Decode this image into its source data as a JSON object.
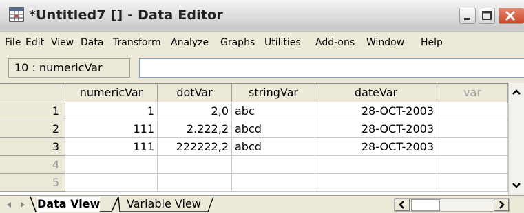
{
  "window": {
    "title": "*Untitled7 [] - Data Editor"
  },
  "menu": [
    "File",
    "Edit",
    "View",
    "Data",
    "Transform",
    "Analyze",
    "Graphs",
    "Utilities",
    "Add-ons",
    "Window",
    "Help"
  ],
  "cell_reference": {
    "label": "10 : numericVar",
    "value": ""
  },
  "grid": {
    "columns": [
      "numericVar",
      "dotVar",
      "stringVar",
      "dateVar",
      "var"
    ],
    "row_numbers": [
      "1",
      "2",
      "3",
      "4",
      "5"
    ],
    "rows": [
      [
        "1",
        "2,0",
        "abc",
        "28-OCT-2003",
        ""
      ],
      [
        "111",
        "2.222,2",
        "abcd",
        "28-OCT-2003",
        ""
      ],
      [
        "111",
        "222222,2",
        "abcd",
        "28-OCT-2003",
        ""
      ],
      [
        "",
        "",
        "",
        "",
        ""
      ],
      [
        "",
        "",
        "",
        "",
        ""
      ]
    ]
  },
  "tabs": {
    "data_view": "Data View",
    "variable_view": "Variable View"
  },
  "icons": {
    "app": "data-editor-grid-icon",
    "minimize": "minimize-icon",
    "maximize": "maximize-icon",
    "close": "close-icon",
    "scroll_up": "arrow-up-icon",
    "scroll_down": "arrow-down-icon",
    "scroll_left": "arrow-left-icon",
    "scroll_right": "arrow-right-icon",
    "tab_prev": "tab-prev-icon",
    "tab_next": "tab-next-icon"
  },
  "colors": {
    "chrome": "#ECE9D8",
    "close_button": "#D9593B",
    "grid_line": "#C8C8C8"
  }
}
